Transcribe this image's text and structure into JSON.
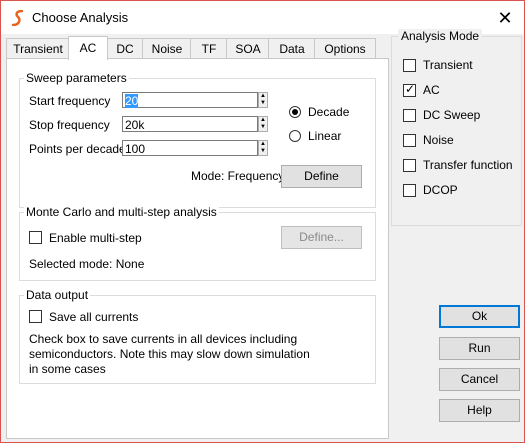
{
  "window": {
    "title": "Choose Analysis",
    "close_glyph": "✕"
  },
  "tabs": [
    {
      "label": "Transient"
    },
    {
      "label": "AC"
    },
    {
      "label": "DC"
    },
    {
      "label": "Noise"
    },
    {
      "label": "TF"
    },
    {
      "label": "SOA"
    },
    {
      "label": "Data"
    },
    {
      "label": "Options"
    }
  ],
  "active_tab": "AC",
  "sweep": {
    "group_label": "Sweep parameters",
    "start_label": "Start frequency",
    "start_value": "20",
    "stop_label": "Stop frequency",
    "stop_value": "20k",
    "ppd_label": "Points per decade",
    "ppd_value": "100",
    "decade_label": "Decade",
    "linear_label": "Linear",
    "mode_text": "Mode: Frequency",
    "define_label": "Define"
  },
  "monte_carlo": {
    "group_label": "Monte Carlo and multi-step analysis",
    "enable_label": "Enable multi-step",
    "define_label": "Define...",
    "selected_mode_text": "Selected mode: None"
  },
  "data_output": {
    "group_label": "Data output",
    "save_label": "Save all currents",
    "note": "Check box to save currents in all devices including semiconductors. Note this may slow down simulation in some cases",
    "note_lines": [
      "Check box to save currents in all devices including",
      "semiconductors. Note this may slow down simulation",
      "in some cases"
    ]
  },
  "analysis_mode": {
    "title": "Analysis Mode",
    "items": [
      {
        "label": "Transient",
        "checked": false
      },
      {
        "label": "AC",
        "checked": true
      },
      {
        "label": "DC Sweep",
        "checked": false
      },
      {
        "label": "Noise",
        "checked": false
      },
      {
        "label": "Transfer function",
        "checked": false
      },
      {
        "label": "DCOP",
        "checked": false
      }
    ]
  },
  "buttons": {
    "ok": "Ok",
    "run": "Run",
    "cancel": "Cancel",
    "help": "Help"
  },
  "colors": {
    "accent": "#0078d7",
    "selection": "#3399ff",
    "app_icon": "#e8621a",
    "frame": "#d9534f"
  },
  "icons": {
    "app": "simetrix-logo-icon",
    "close": "close-icon",
    "spin_up": "spin-up-icon",
    "spin_down": "spin-down-icon"
  }
}
